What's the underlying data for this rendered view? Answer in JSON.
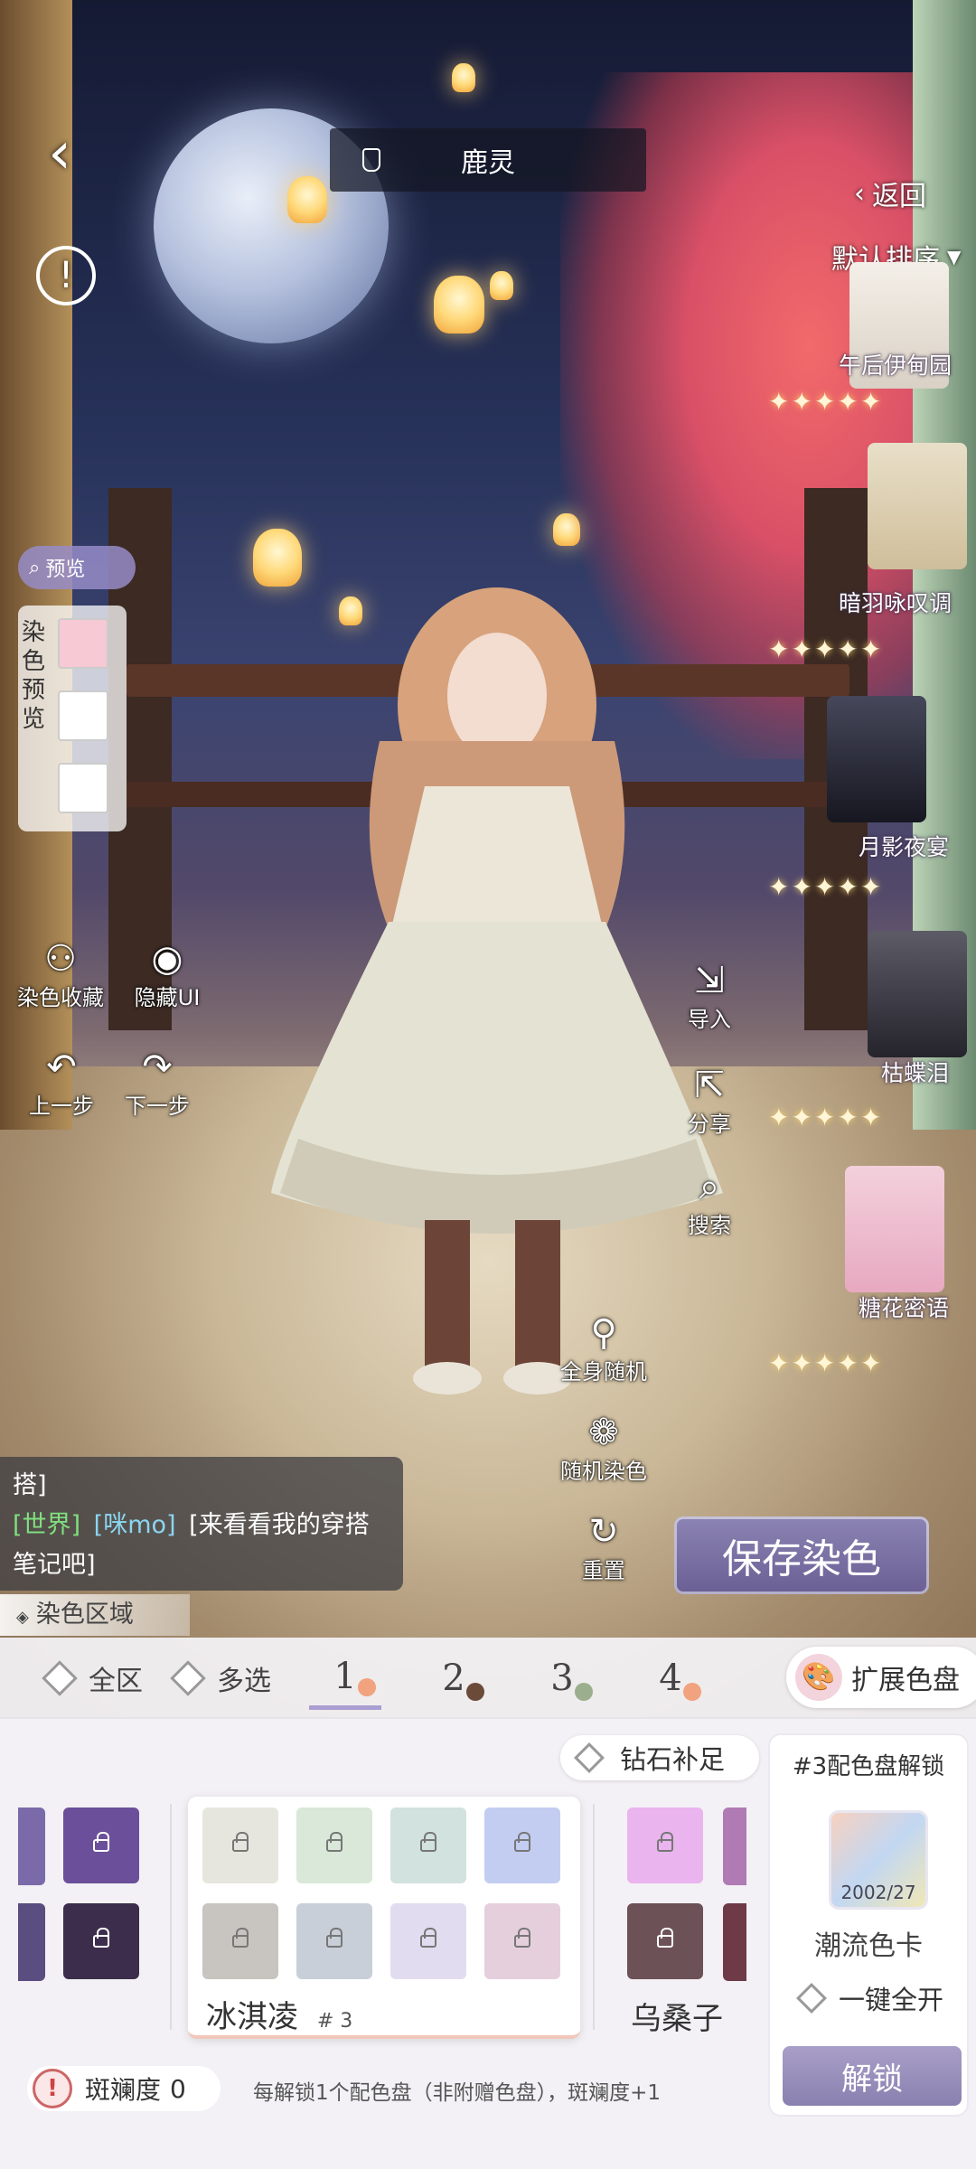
{
  "title": {
    "label": "鹿灵"
  },
  "left_tools": {
    "preview_label": "预览",
    "dye_preview_label": "染色预览",
    "dye_collect": "染色收藏",
    "hide_ui": "隐藏UI",
    "undo": "上一步",
    "redo": "下一步"
  },
  "right_panel": {
    "back": "返回",
    "sort": "默认排序",
    "outfits": [
      {
        "name": "午后伊甸园"
      },
      {
        "name": "暗羽咏叹调"
      },
      {
        "name": "月影夜宴"
      },
      {
        "name": "枯蝶泪"
      },
      {
        "name": "糖花密语"
      }
    ]
  },
  "center_tools": {
    "import": "导入",
    "share": "分享",
    "search": "搜索",
    "full_random": "全身随机",
    "random_dye": "随机染色",
    "reset": "重置"
  },
  "chat": {
    "line1": "搭]",
    "channel": "[世界]",
    "user": "[咪mo]",
    "msg1": "[来看看我的穿搭",
    "msg2": "笔记吧]"
  },
  "save_button": "保存染色",
  "dye_area_label": "染色区域",
  "tabs": {
    "all": "全区",
    "multi": "多选",
    "numbers": [
      "1",
      "2",
      "3",
      "4"
    ],
    "expand": "扩展色盘"
  },
  "palettes": {
    "diamond_fill": "钻石补足",
    "center_name": "冰淇凌",
    "center_index": "# 3",
    "right_name": "乌桑子",
    "center_colors": [
      "#e6e6df",
      "#d9e8d8",
      "#d2e2de",
      "#c3cdf2",
      "#c8c4bf",
      "#c9cfd8",
      "#e2dcf0",
      "#e6cfdc"
    ],
    "left_colors": [
      "#6b4f9a",
      "#3d2d4c"
    ],
    "right_colors": [
      "#eab4ee",
      "#6c5157"
    ]
  },
  "unlock_card": {
    "title": "#3配色盘解锁",
    "item_name": "潮流色卡",
    "item_count": "2002/27",
    "one_click": "一键全开",
    "unlock_button": "解锁"
  },
  "footer": {
    "spot_label": "斑斓度",
    "spot_value": "0",
    "note": "每解锁1个配色盘（非附赠色盘），斑斓度+1"
  }
}
